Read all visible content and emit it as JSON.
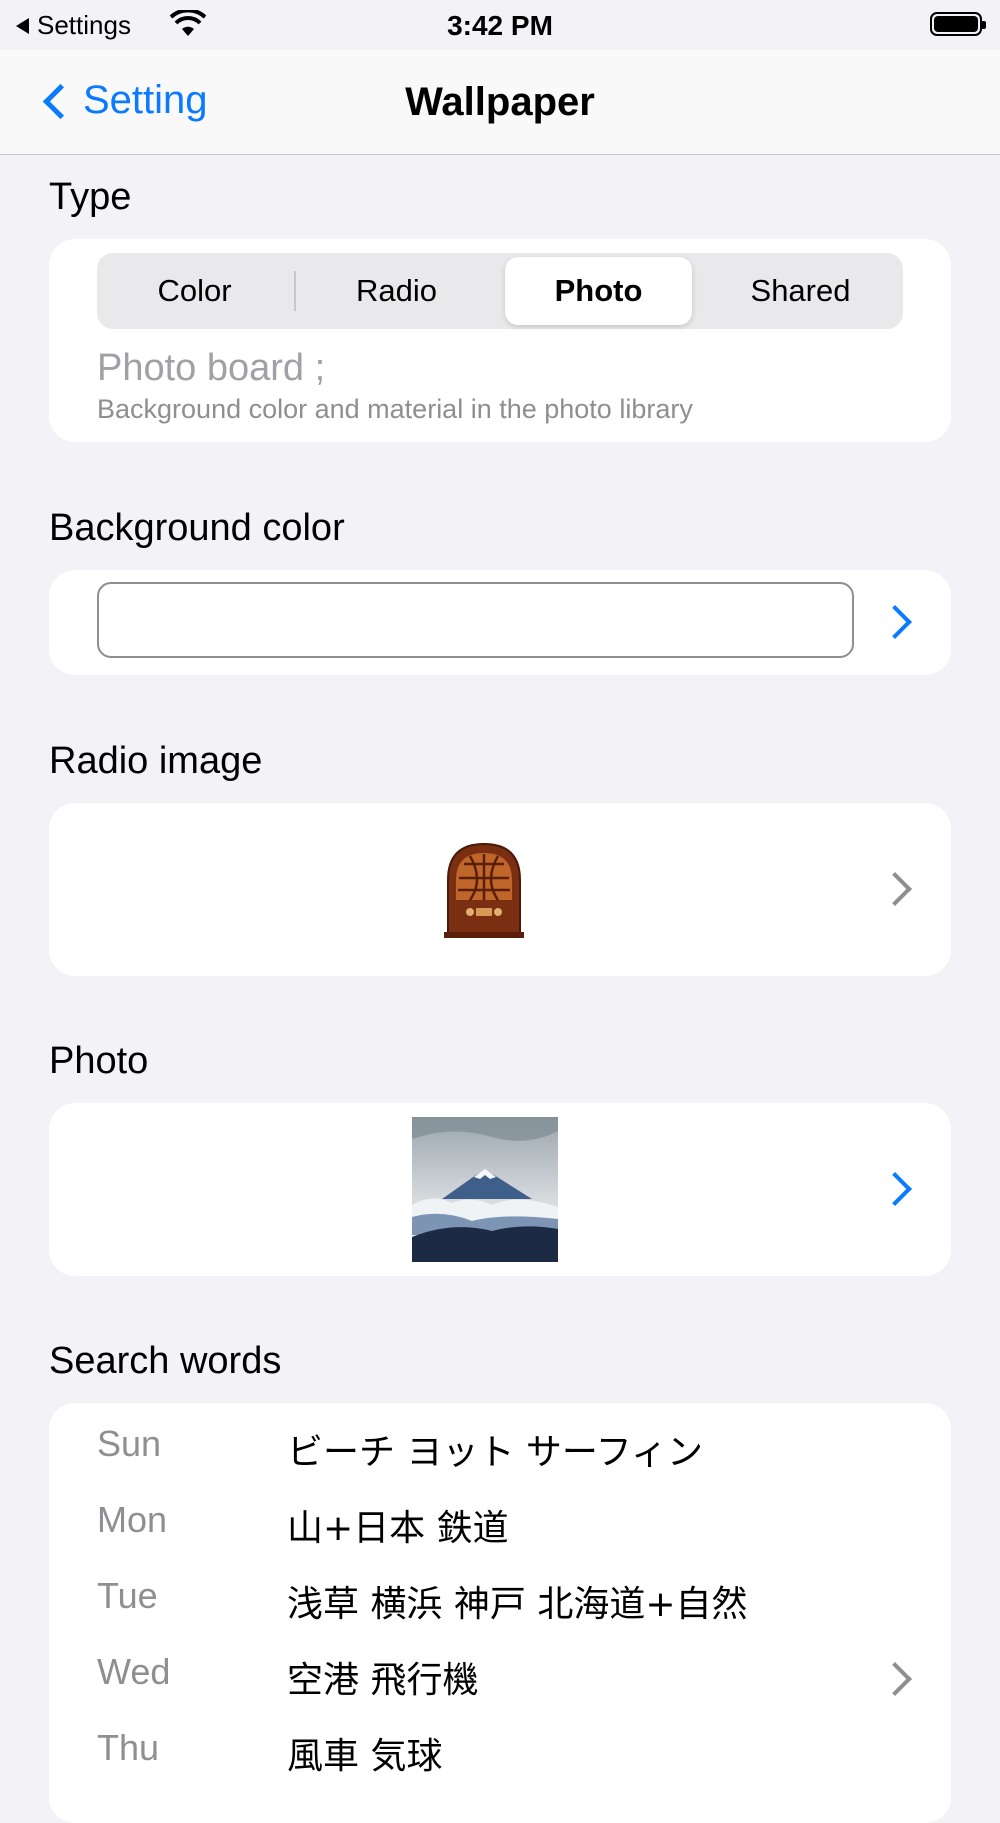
{
  "status_bar": {
    "back_app": "Settings",
    "time": "3:42 PM"
  },
  "nav": {
    "back_label": "Setting",
    "title": "Wallpaper"
  },
  "type_section": {
    "title": "Type",
    "segments": [
      "Color",
      "Radio",
      "Photo",
      "Shared"
    ],
    "selected": "Photo",
    "description_title": "Photo board ;",
    "description_sub": "Background color and material in the photo library"
  },
  "background_color_section": {
    "title": "Background color"
  },
  "radio_image_section": {
    "title": "Radio image"
  },
  "photo_section": {
    "title": "Photo"
  },
  "search_words_section": {
    "title": "Search words",
    "rows": [
      {
        "day": "Sun",
        "words": "ビーチ ヨット サーフィン"
      },
      {
        "day": "Mon",
        "words": "山+日本 鉄道"
      },
      {
        "day": "Tue",
        "words": "浅草 横浜 神戸 北海道+自然"
      },
      {
        "day": "Wed",
        "words": "空港 飛行機"
      },
      {
        "day": "Thu",
        "words": "風車 気球"
      }
    ]
  },
  "colors": {
    "accent": "#0a7aff",
    "background": "#f2f2f7",
    "card": "#ffffff",
    "secondary_text": "#8e8e93"
  },
  "icons": [
    "wifi-icon",
    "battery-icon",
    "back-chevron-icon",
    "chevron-right-icon",
    "radio-thumbnail",
    "photo-thumbnail"
  ]
}
